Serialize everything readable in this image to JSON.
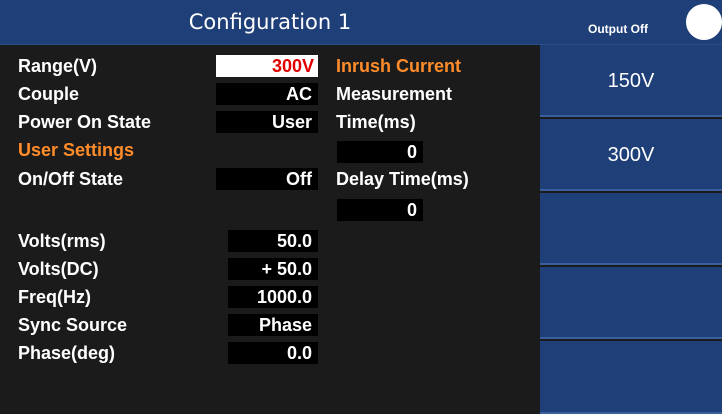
{
  "title": "Configuration 1",
  "status": {
    "output_text": "Output Off"
  },
  "settings": {
    "range": {
      "label": "Range(V)",
      "value": "300V"
    },
    "couple": {
      "label": "Couple",
      "value": "AC"
    },
    "power_on_state": {
      "label": "Power On State",
      "value": "User"
    },
    "user_settings_heading": "User Settings",
    "on_off_state": {
      "label": "On/Off State",
      "value": "Off"
    },
    "volts_rms": {
      "label": "Volts(rms)",
      "value": "50.0"
    },
    "volts_dc": {
      "label": "Volts(DC)",
      "value": "+ 50.0"
    },
    "freq": {
      "label": "Freq(Hz)",
      "value": "1000.0"
    },
    "sync_source": {
      "label": "Sync Source",
      "value": "Phase"
    },
    "phase": {
      "label": "Phase(deg)",
      "value": "0.0"
    }
  },
  "inrush": {
    "heading": "Inrush Current",
    "measurement_label": "Measurement",
    "time_label": "Time(ms)",
    "time_value": "0",
    "delay_label": "Delay Time(ms)",
    "delay_value": "0"
  },
  "softkeys": [
    "150V",
    "300V",
    "",
    "",
    ""
  ],
  "colors": {
    "panel_blue": "#1f3f78",
    "highlight_orange": "#ff8c2a",
    "active_value_red": "#e00000"
  }
}
